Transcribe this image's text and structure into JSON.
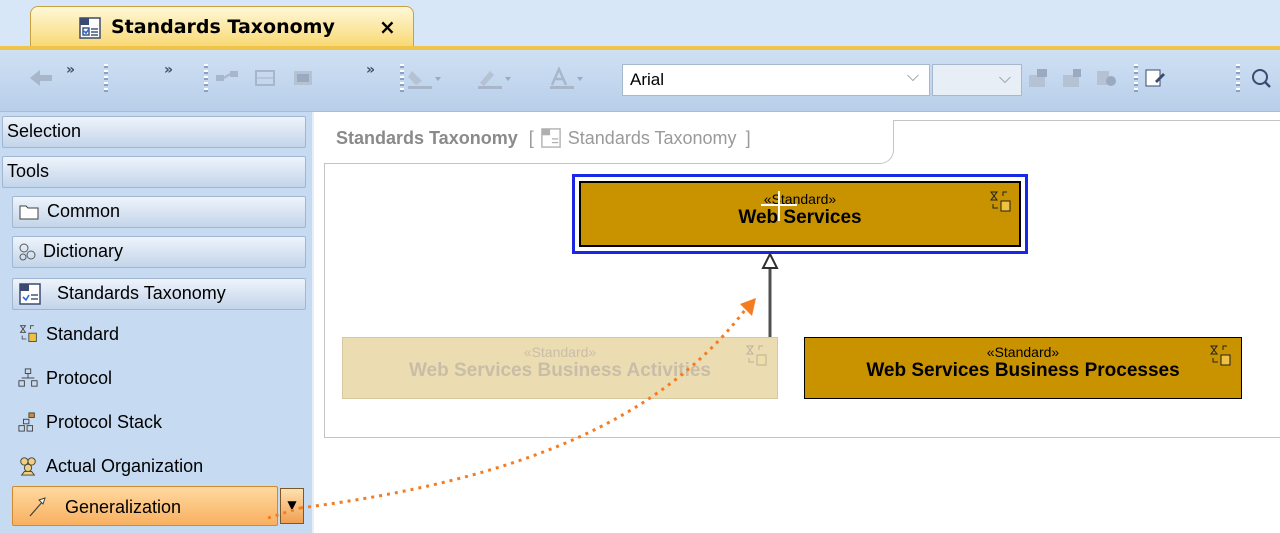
{
  "tab": {
    "title": "Standards Taxonomy",
    "close_label": "×"
  },
  "toolbar": {
    "font_name": "Arial",
    "font_size": ""
  },
  "palette": {
    "groups": [
      {
        "label": "Selection"
      },
      {
        "label": "Tools"
      },
      {
        "label": "Common"
      },
      {
        "label": "Dictionary"
      },
      {
        "label": "Standards Taxonomy"
      }
    ],
    "items": [
      {
        "label": "Standard",
        "icon": "standard-icon"
      },
      {
        "label": "Protocol",
        "icon": "protocol-icon"
      },
      {
        "label": "Protocol Stack",
        "icon": "protocol-stack-icon"
      },
      {
        "label": "Actual Organization",
        "icon": "organization-icon"
      },
      {
        "label": "Generalization",
        "icon": "generalization-icon"
      }
    ]
  },
  "diagram": {
    "name": "Standards Taxonomy",
    "bracket_open": "[",
    "bracket_close": "]",
    "type_label": "Standards Taxonomy",
    "blocks": [
      {
        "stereotype": "«Standard»",
        "name": "Web Services",
        "state": "selected"
      },
      {
        "stereotype": "«Standard»",
        "name": "Web Services Business Activities",
        "state": "faded"
      },
      {
        "stereotype": "«Standard»",
        "name": "Web Services Business Processes",
        "state": "normal"
      }
    ]
  },
  "colors": {
    "block_fill": "#c99300",
    "selection_border": "#1a28e6",
    "drag_hint": "#f57c20",
    "palette_bg": "#c6daf1"
  }
}
